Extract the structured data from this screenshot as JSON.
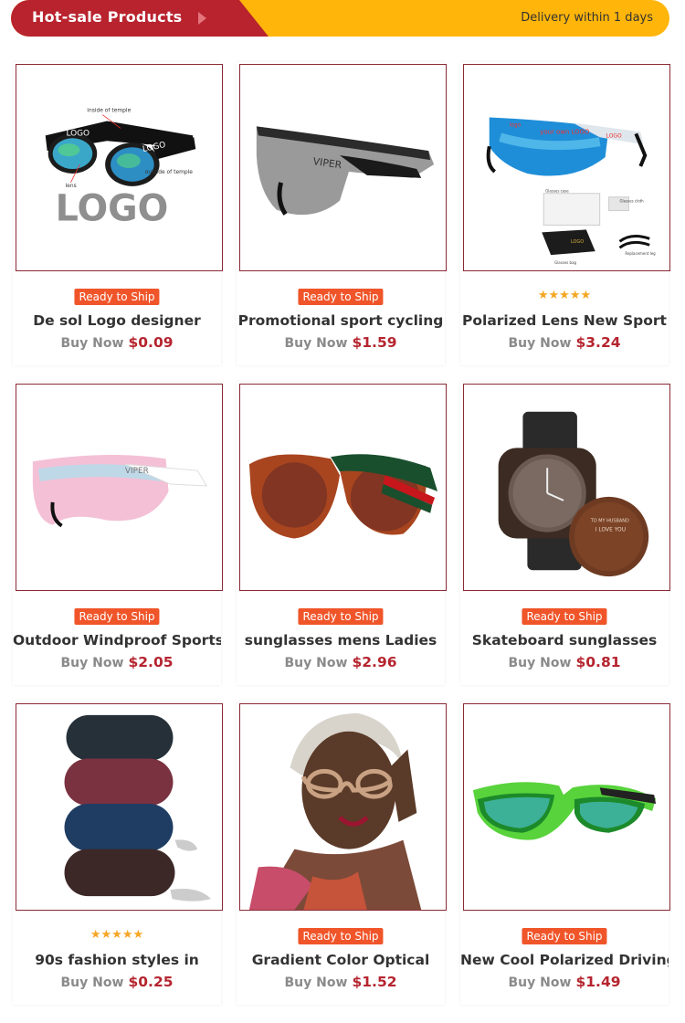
{
  "header": {
    "title": "Hot-sale Products",
    "delivery": "Delivery within 1 days",
    "colors": {
      "red": "#b8232e",
      "yellow": "#ffb50a"
    }
  },
  "products": [
    {
      "tag": "Ready to Ship",
      "title": "De sol Logo designer",
      "buy": "Buy Now",
      "price": "$0.09",
      "image_icon": "sunglasses-logo-diagram-image",
      "logo_text": "LOGO",
      "inside_label": "inside of temple",
      "outside_label": "outside of temple",
      "lens_label": "lens"
    },
    {
      "tag": "Ready to Ship",
      "title": "Promotional sport cycling",
      "buy": "Buy Now",
      "price": "$1.59",
      "image_icon": "grey-shield-sunglasses-image",
      "brand": "VIPER"
    },
    {
      "tag": "stars",
      "rating": 5,
      "title": "Polarized Lens New Sport",
      "buy": "Buy Now",
      "price": "$3.24",
      "image_icon": "blue-mirror-sport-sunglasses-image",
      "kit_labels": [
        "your own LOGO",
        "LOGO",
        "logo",
        "Glasses case",
        "Glasses cloth",
        "Glasses bag",
        "Replacement leg"
      ]
    },
    {
      "tag": "Ready to Ship",
      "title": "Outdoor Windproof Sports",
      "buy": "Buy Now",
      "price": "$2.05",
      "image_icon": "pink-mirror-sport-sunglasses-image",
      "brand": "VIPER"
    },
    {
      "tag": "Ready to Ship",
      "title": "sunglasses mens Ladies",
      "buy": "Buy Now",
      "price": "$2.96",
      "image_icon": "cat-eye-stripe-sunglasses-image"
    },
    {
      "tag": "Ready to Ship",
      "title": "Skateboard sunglasses",
      "buy": "Buy Now",
      "price": "$0.81",
      "image_icon": "wooden-watch-image",
      "engraving": "TO MY HUSBAND I LOVE YOU"
    },
    {
      "tag": "stars",
      "rating": 5,
      "title": "90s fashion styles in",
      "buy": "Buy Now",
      "price": "$0.25",
      "image_icon": "stacked-glasses-cases-image"
    },
    {
      "tag": "Ready to Ship",
      "title": "Gradient Color Optical",
      "buy": "Buy Now",
      "price": "$1.52",
      "image_icon": "woman-wearing-glasses-image"
    },
    {
      "tag": "Ready to Ship",
      "title": "New Cool Polarized Driving",
      "buy": "Buy Now",
      "price": "$1.49",
      "image_icon": "green-sport-sunglasses-image"
    }
  ]
}
